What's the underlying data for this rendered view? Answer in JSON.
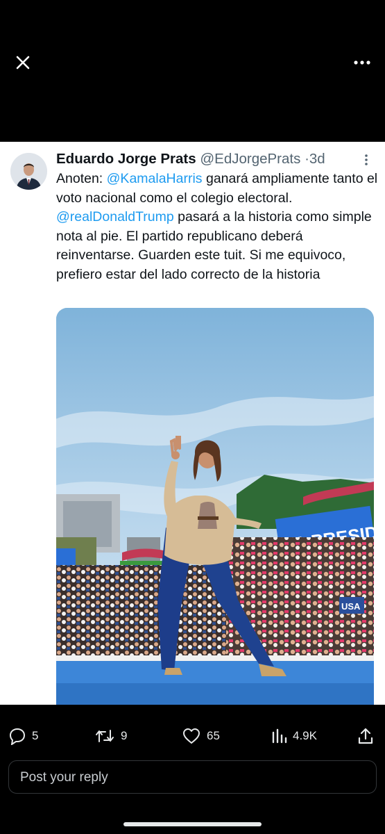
{
  "tweet": {
    "author_name": "Eduardo Jorge Prats",
    "author_handle": "@EdJorgePrats",
    "separator": "·",
    "time": "3d",
    "text_p1": "Anoten: ",
    "mention1": "@KamalaHarris",
    "text_p2": " ganará ampliamente tanto el voto nacional como el colegio electoral. ",
    "mention2": "@realDonaldTrump",
    "text_p3": " pasará a la historia como simple nota al pie. El partido republicano deberá reinventarse. Guarden este tuit. Si me equivoco, prefiero estar del lado correcto de la historia",
    "image": {
      "banner_text": "A PRESIDENT",
      "sign_text": "USA"
    }
  },
  "stats": {
    "replies": "5",
    "reposts": "9",
    "likes": "65",
    "views": "4.9K"
  },
  "reply": {
    "placeholder": "Post your reply"
  },
  "icons": {
    "close": "close-icon",
    "more": "more-horizontal-icon",
    "caret": "chevron-down-icon",
    "reply": "reply-icon",
    "repost": "repost-icon",
    "like": "heart-icon",
    "views": "views-icon",
    "share": "share-icon"
  },
  "colors": {
    "link": "#1d9bf0",
    "secondary_text": "#536471",
    "background": "#000000"
  }
}
